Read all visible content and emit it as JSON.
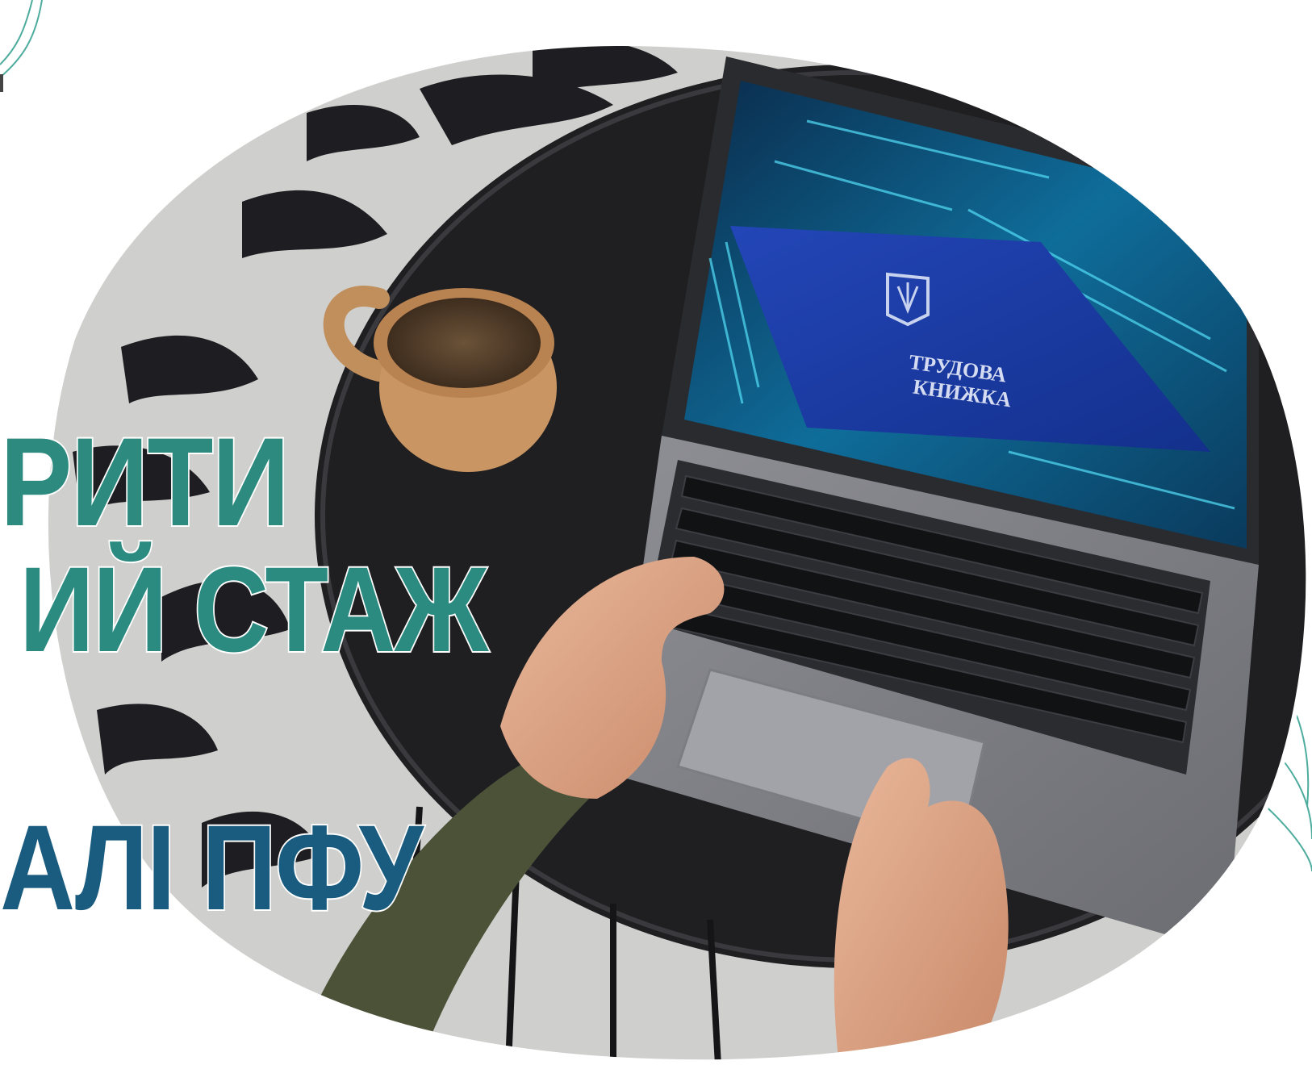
{
  "headline": {
    "line_1": "РИТИ",
    "line_2": "ИЙ СТАЖ",
    "line_3": "АЛІ ПФУ"
  },
  "screen_book": {
    "title_line_1": "ТРУДОВА",
    "title_line_2": "КНИЖКА"
  },
  "icons": [
    "trident-emblem-icon"
  ],
  "colors": {
    "headline_green": "#2d8a7f",
    "headline_blue": "#1a5c80",
    "decor_line": "#2e9e8c",
    "book_blue": "#1b3fa8",
    "table": "#1f1f21"
  }
}
